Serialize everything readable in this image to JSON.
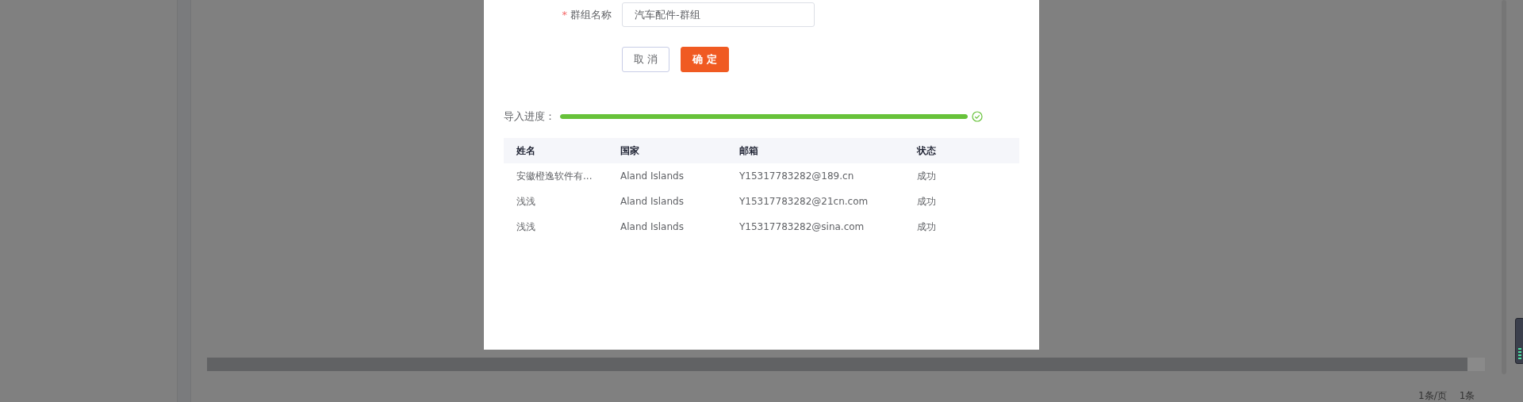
{
  "form": {
    "required_mark": "*",
    "field_label": "群组名称",
    "value": "汽车配件-群组"
  },
  "buttons": [
    {
      "label": "取 消",
      "kind": "default"
    },
    {
      "label": "确 定",
      "kind": "primary"
    }
  ],
  "progress": {
    "label": "导入进度：",
    "level": 1
  },
  "table": {
    "columns": [
      "姓名",
      "国家",
      "邮箱",
      "状态"
    ],
    "rows": [
      [
        "安徽橙逸软件有...",
        "Aland Islands",
        "Y15317783282@189.cn",
        "成功"
      ],
      [
        "浅浅",
        "Aland Islands",
        "Y15317783282@21cn.com",
        "成功"
      ],
      [
        "浅浅",
        "Aland Islands",
        "Y15317783282@sina.com",
        "成功"
      ]
    ]
  },
  "pagination": {
    "page_size": "1条/页",
    "total": "1条"
  }
}
